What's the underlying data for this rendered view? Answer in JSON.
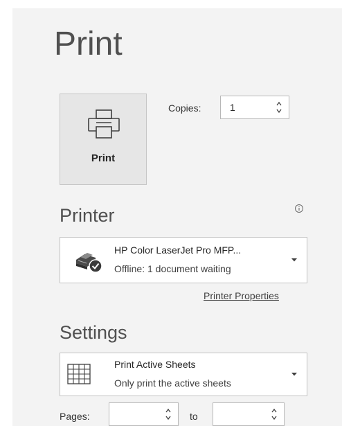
{
  "page": {
    "title": "Print"
  },
  "print_button": {
    "label": "Print",
    "icon": "printer-icon"
  },
  "copies": {
    "label": "Copies:",
    "value": "1"
  },
  "printer": {
    "header": "Printer",
    "info_icon": "info-icon",
    "name": "HP Color LaserJet Pro MFP...",
    "status": "Offline: 1 document waiting",
    "icon": "printer-offline-icon",
    "properties_link": "Printer Properties"
  },
  "settings": {
    "header": "Settings",
    "scope": {
      "title": "Print Active Sheets",
      "description": "Only print the active sheets",
      "icon": "sheet-grid-icon"
    },
    "pages": {
      "label": "Pages:",
      "from_value": "",
      "to_label": "to",
      "to_value": ""
    }
  }
}
